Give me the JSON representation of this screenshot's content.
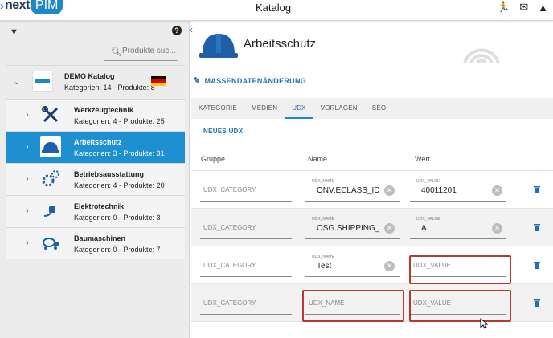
{
  "header": {
    "logo_next": "next",
    "logo_pim": "PIM",
    "title": "Katalog"
  },
  "sidebar": {
    "search_placeholder": "Produkte suc...",
    "root": {
      "name": "DEMO Katalog",
      "meta": "Kategorien: 14 - Produkte: 8"
    },
    "items": [
      {
        "name": "Werkzeugtechnik",
        "meta": "Kategorien: 4 - Produkte: 25",
        "icon": "tools-icon"
      },
      {
        "name": "Arbeitsschutz",
        "meta": "Kategorien: 3 - Produkte: 31",
        "icon": "hardhat-icon",
        "active": true
      },
      {
        "name": "Betriebsausstattung",
        "meta": "Kategorien: 4 - Produkte: 20",
        "icon": "gears-icon"
      },
      {
        "name": "Elektrotechnik",
        "meta": "Kategorien: 0 - Produkte: 3",
        "icon": "plug-icon"
      },
      {
        "name": "Baumaschinen",
        "meta": "Kategorien: 0 - Produkte: 7",
        "icon": "cement-truck-icon"
      }
    ]
  },
  "main": {
    "category_title": "Arbeitsschutz",
    "mass_edit_label": "MASSENDATENÄNDERUNG",
    "tabs": [
      "KATEGORIE",
      "MEDIEN",
      "UDX",
      "VORLAGEN",
      "SEO"
    ],
    "active_tab": "UDX",
    "new_udx_label": "NEUES UDX",
    "columns": {
      "group": "Gruppe",
      "name": "Name",
      "value": "Wert"
    },
    "rows": [
      {
        "group_placeholder": "UDX_CATEGORY",
        "name_label": "UDX_NAME",
        "name": "ONV.ECLASS_ID",
        "value_label": "UDX_VALUE",
        "value": "40011201"
      },
      {
        "group_placeholder": "UDX_CATEGORY",
        "name_label": "UDX_NAME",
        "name": "OSG.SHIPPING_MA",
        "value_label": "UDX_VALUE",
        "value": "A"
      },
      {
        "group_placeholder": "UDX_CATEGORY",
        "name_label": "UDX_NAME",
        "name": "Test",
        "value_placeholder": "UDX_VALUE"
      },
      {
        "group_placeholder": "UDX_CATEGORY",
        "name_placeholder": "UDX_NAME",
        "value_placeholder": "UDX_VALUE"
      }
    ]
  },
  "colors": {
    "accent": "#1e88c8",
    "active_row": "#1e8fd0",
    "highlight": "#b5392f"
  }
}
